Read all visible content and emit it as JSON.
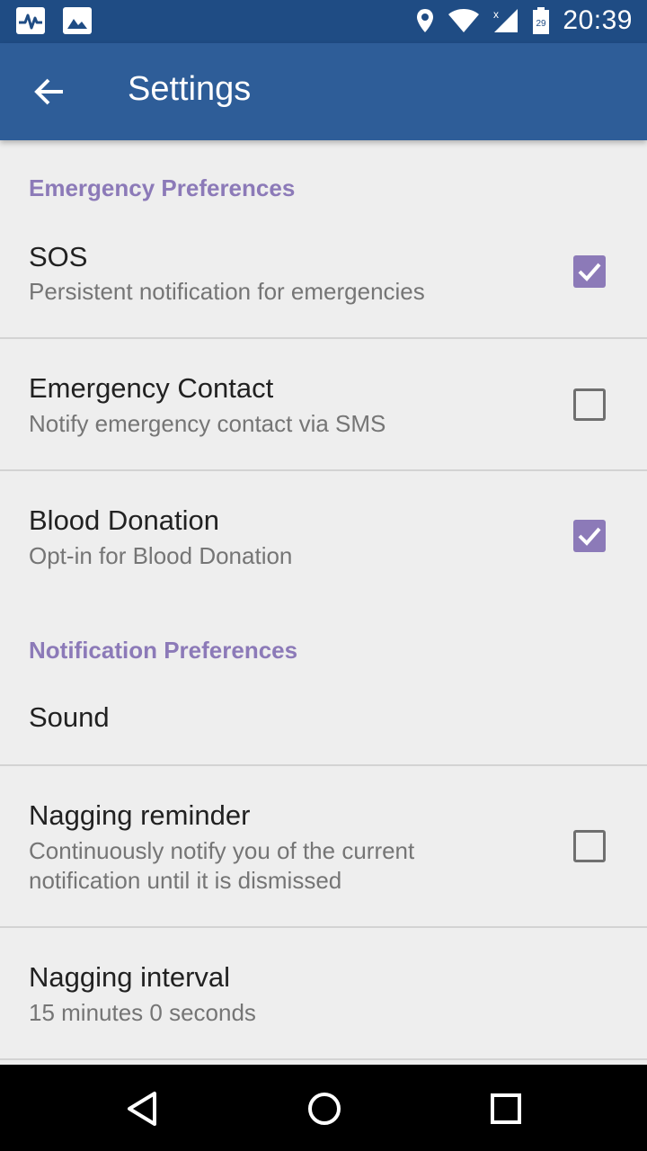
{
  "status_bar": {
    "time": "20:39",
    "battery_level": "29",
    "icons": [
      "pulse-icon",
      "image-icon",
      "location-icon",
      "wifi-icon",
      "signal-icon",
      "battery-icon"
    ]
  },
  "app_bar": {
    "title": "Settings",
    "back_icon": "arrow-left-icon",
    "color": "#2e5d98"
  },
  "sections": {
    "emergency": "Emergency Preferences",
    "notification": "Notification Preferences"
  },
  "items": {
    "sos": {
      "title": "SOS",
      "summary": "Persistent notification for emergencies",
      "checked": true
    },
    "emergency_contact": {
      "title": "Emergency Contact",
      "summary": "Notify emergency contact via SMS",
      "checked": false
    },
    "blood_donation": {
      "title": "Blood Donation",
      "summary": "Opt-in for Blood Donation",
      "checked": true
    },
    "sound": {
      "title": "Sound"
    },
    "nagging_reminder": {
      "title": "Nagging reminder",
      "summary": "Continuously notify you of the current notification until it is dismissed",
      "checked": false
    },
    "nagging_interval": {
      "title": "Nagging interval",
      "summary": "15 minutes 0 seconds"
    }
  },
  "accent_color": "#8c7ab8",
  "nav_bar": {
    "icons": [
      "back-triangle-icon",
      "home-circle-icon",
      "recents-square-icon"
    ]
  }
}
